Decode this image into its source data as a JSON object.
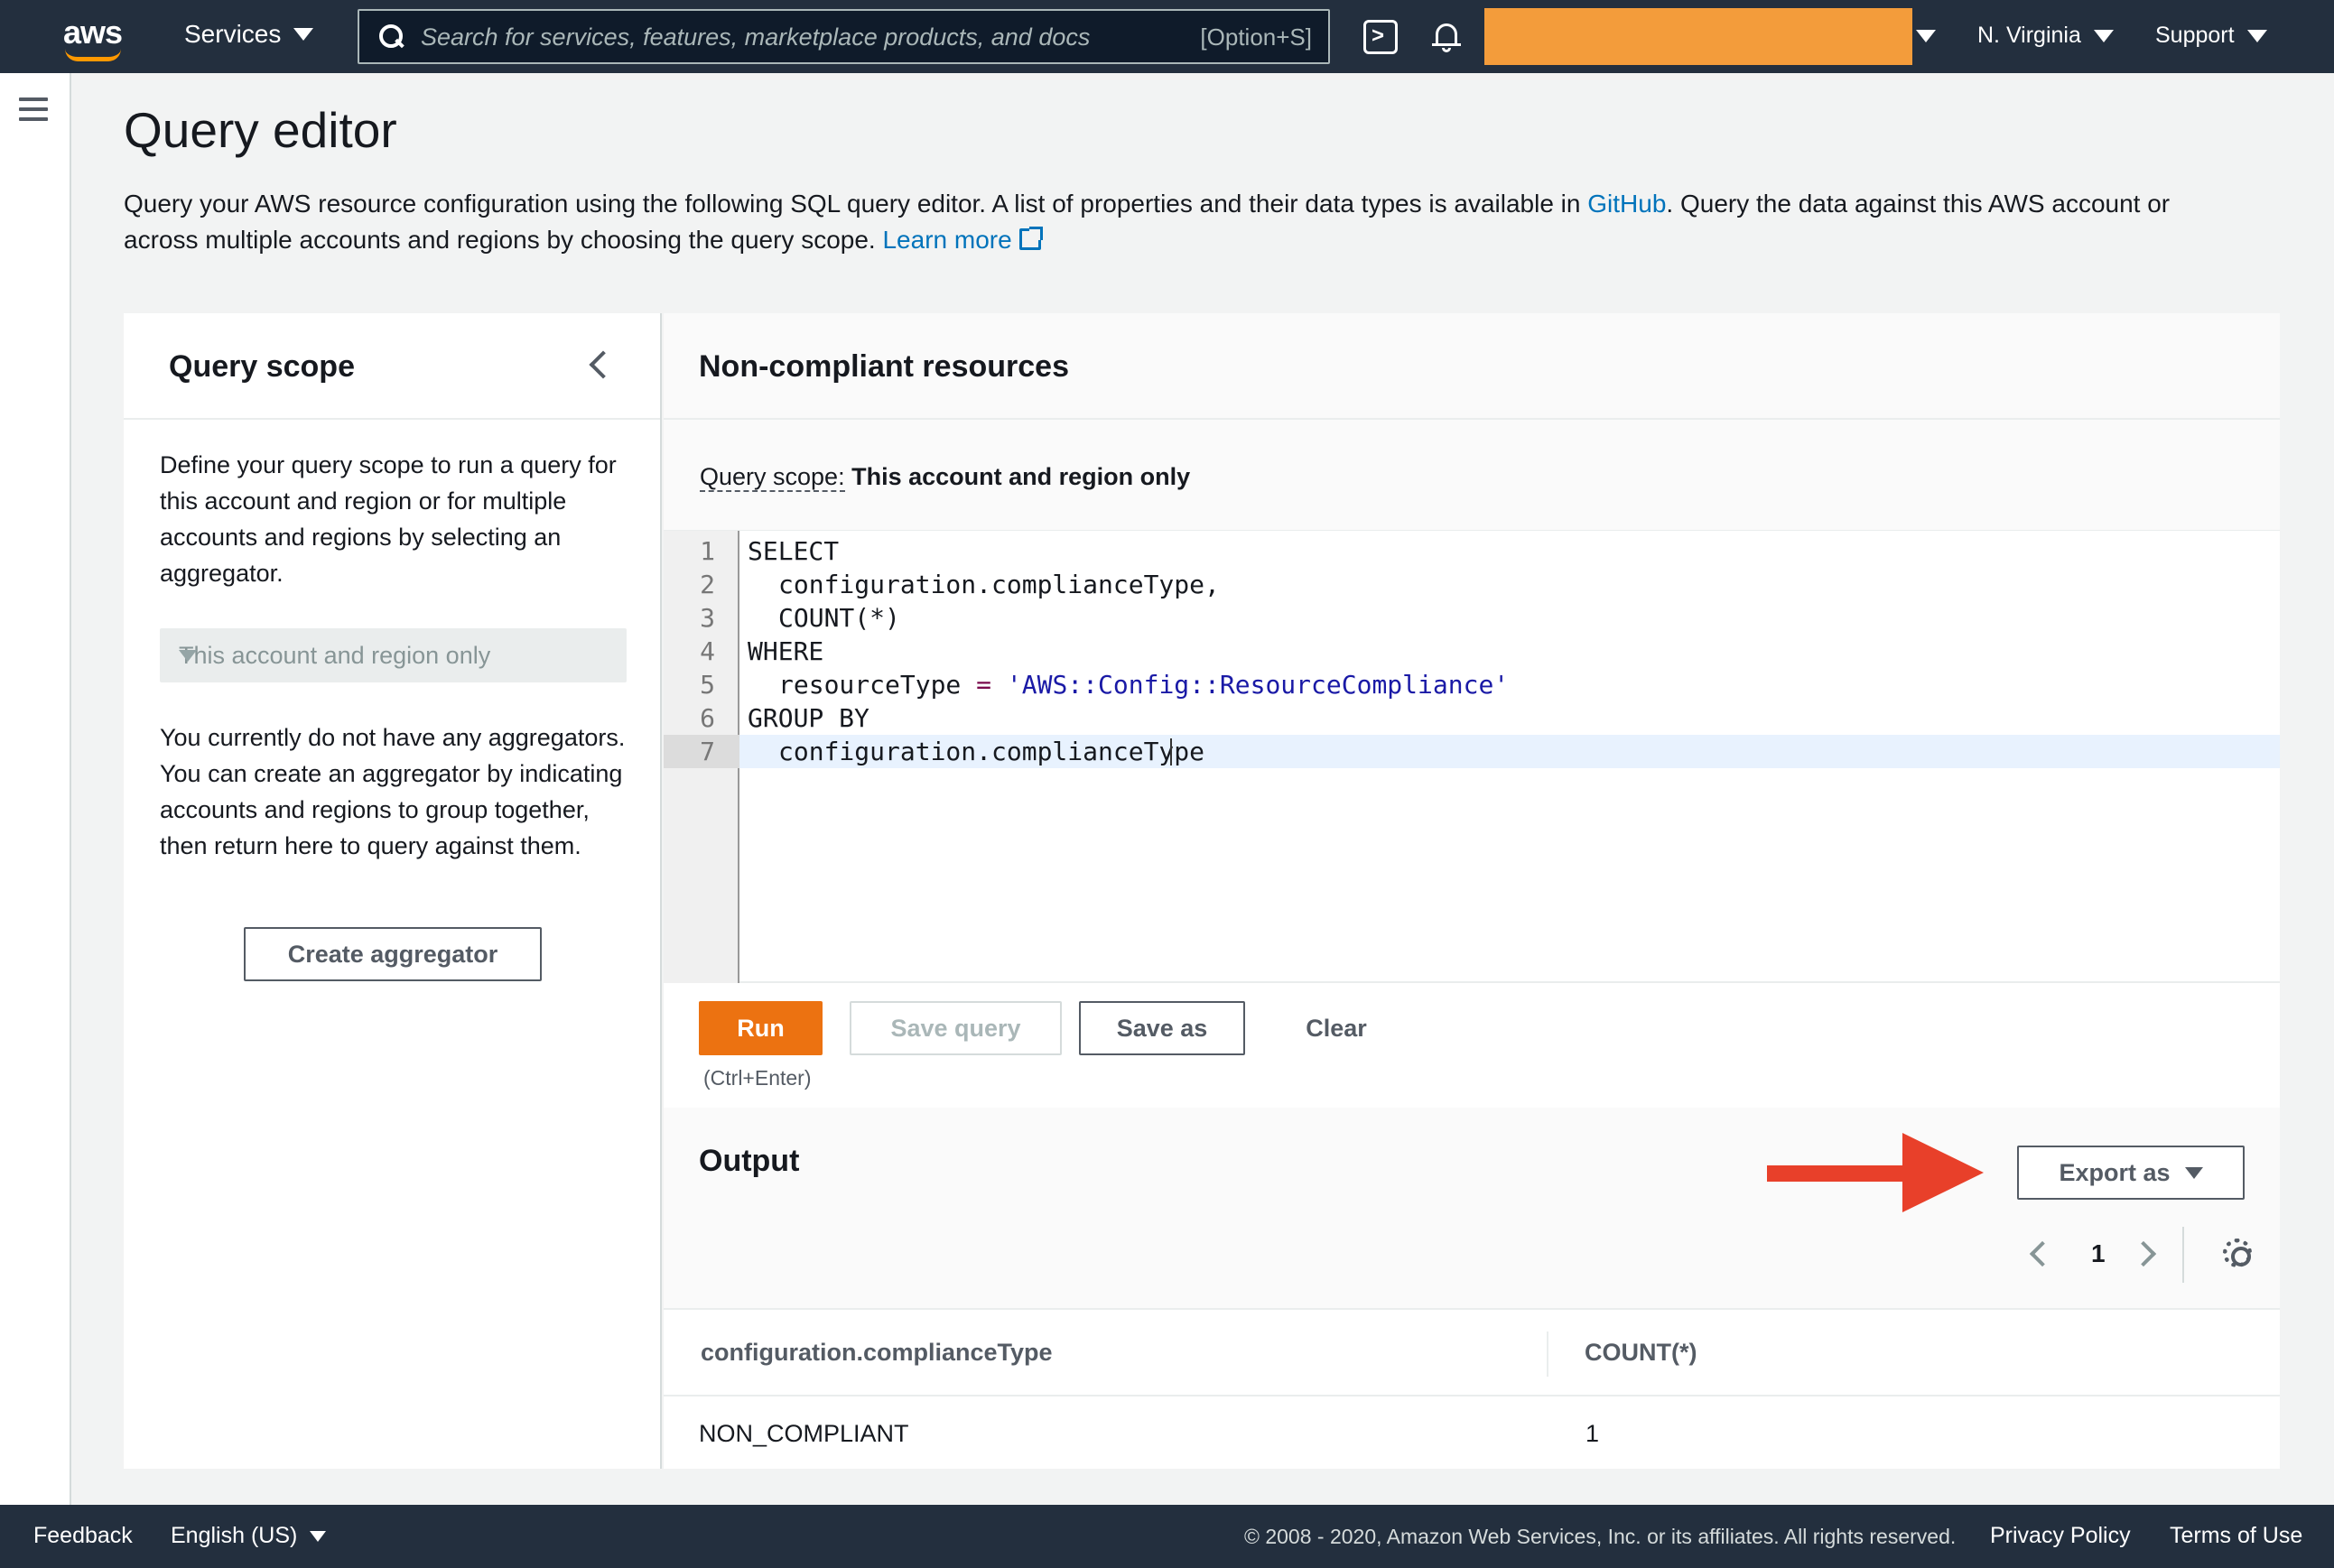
{
  "nav": {
    "logo": "aws",
    "services": "Services",
    "search_placeholder": "Search for services, features, marketplace products, and docs",
    "search_shortcut": "[Option+S]",
    "region": "N. Virginia",
    "support": "Support",
    "account_color": "#f39c3b"
  },
  "page": {
    "title": "Query editor",
    "desc_part1": "Query your AWS resource configuration using the following SQL query editor. A list of properties and their data types is available in ",
    "desc_link_github": "GitHub",
    "desc_part2": ". Query the data against this AWS account or across multiple accounts and regions by choosing the query scope. ",
    "desc_link_learn": "Learn more"
  },
  "scope": {
    "title": "Query scope",
    "desc": "Define your query scope to run a query for this account and region or for multiple accounts and regions by selecting an aggregator.",
    "select_value": "This account and region only",
    "note": "You currently do not have any aggregators. You can create an aggregator by indicating accounts and regions to group together, then return here to query against them.",
    "create_button": "Create aggregator"
  },
  "editor": {
    "title": "Non-compliant resources",
    "scope_label": "Query scope:",
    "scope_value": "This account and region only",
    "lines": [
      {
        "num": "1",
        "text": "SELECT"
      },
      {
        "num": "2",
        "text": "configuration.complianceType,"
      },
      {
        "num": "3",
        "text": "COUNT(*)"
      },
      {
        "num": "4",
        "text": "WHERE"
      },
      {
        "num": "5",
        "text": "resourceType = 'AWS::Config::ResourceCompliance'"
      },
      {
        "num": "6",
        "text": "GROUP BY"
      },
      {
        "num": "7",
        "text": "configuration.complianceType"
      }
    ],
    "run": "Run",
    "run_hint": "(Ctrl+Enter)",
    "save_query": "Save query",
    "save_as": "Save as",
    "clear": "Clear"
  },
  "output": {
    "title": "Output",
    "export": "Export as",
    "page": "1",
    "columns": [
      "configuration.complianceType",
      "COUNT(*)"
    ],
    "rows": [
      [
        "NON_COMPLIANT",
        "1"
      ]
    ],
    "arrow_color": "#e8402a"
  },
  "footer": {
    "feedback": "Feedback",
    "language": "English (US)",
    "copyright": "© 2008 - 2020, Amazon Web Services, Inc. or its affiliates. All rights reserved.",
    "privacy": "Privacy Policy",
    "terms": "Terms of Use"
  }
}
